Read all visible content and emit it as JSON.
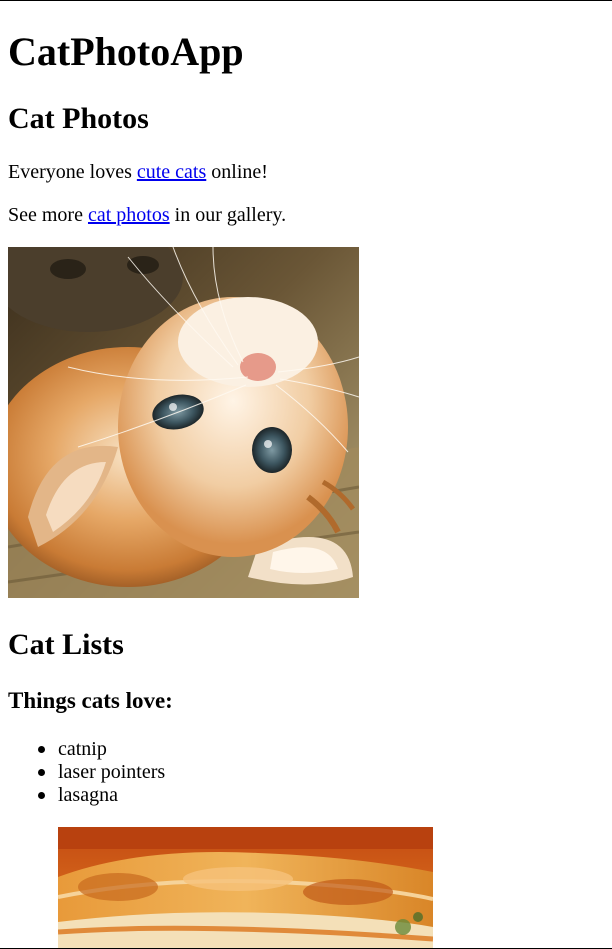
{
  "page": {
    "app_title": "CatPhotoApp",
    "section_photos_heading": "Cat Photos",
    "intro": {
      "before": "Everyone loves ",
      "link": "cute cats",
      "after": " online!"
    },
    "gallery_line": {
      "before": "See more ",
      "link": "cat photos",
      "after": " in our gallery."
    },
    "section_lists_heading": "Cat Lists",
    "things_heading": "Things cats love:",
    "things_cats_love": [
      "catnip",
      "laser pointers",
      "lasagna"
    ]
  },
  "colors": {
    "link": "#0000ee",
    "text": "#000000",
    "background": "#ffffff"
  },
  "images": {
    "cat_photo_icon": "orange-kitten-photo",
    "lasagna_photo_icon": "lasagna-photo"
  }
}
